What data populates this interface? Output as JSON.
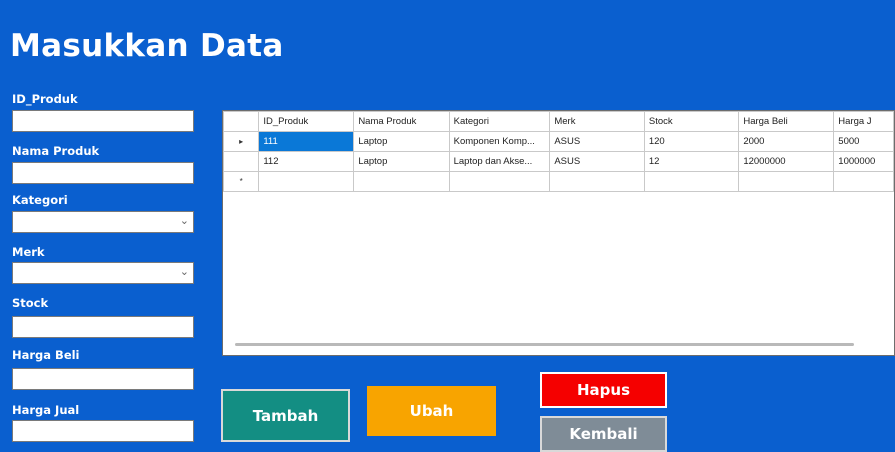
{
  "form": {
    "title": "Masukkan Data",
    "labels": {
      "id_produk": "ID_Produk",
      "nama_produk": "Nama Produk",
      "kategori": "Kategori",
      "merk": "Merk",
      "stock": "Stock",
      "harga_beli": "Harga Beli",
      "harga_jual": "Harga Jual"
    },
    "values": {
      "id_produk": "",
      "nama_produk": "",
      "kategori": "",
      "merk": "",
      "stock": "",
      "harga_beli": "",
      "harga_jual": ""
    },
    "dropdown_icon": "chevron-down-icon"
  },
  "grid": {
    "columns": [
      "ID_Produk",
      "Nama Produk",
      "Kategori",
      "Merk",
      "Stock",
      "Harga Beli",
      "Harga J"
    ],
    "rows": [
      {
        "indicator": "▸",
        "cells": [
          "111",
          "Laptop",
          "Komponen Komp...",
          "ASUS",
          "120",
          "2000",
          "5000"
        ]
      },
      {
        "indicator": "",
        "cells": [
          "112",
          "Laptop",
          "Laptop dan Akse...",
          "ASUS",
          "12",
          "12000000",
          "1000000"
        ]
      },
      {
        "indicator": "*",
        "cells": [
          "",
          "",
          "",
          "",
          "",
          "",
          ""
        ]
      }
    ],
    "selection_color": "#0a78d7"
  },
  "buttons": {
    "tambah": "Tambah",
    "ubah": "Ubah",
    "hapus": "Hapus",
    "kembali": "Kembali"
  },
  "colors": {
    "background": "#0a5fcf",
    "tambah": "#138e83",
    "ubah": "#f8a400",
    "hapus": "#f50000",
    "kembali": "#7f8c97"
  }
}
